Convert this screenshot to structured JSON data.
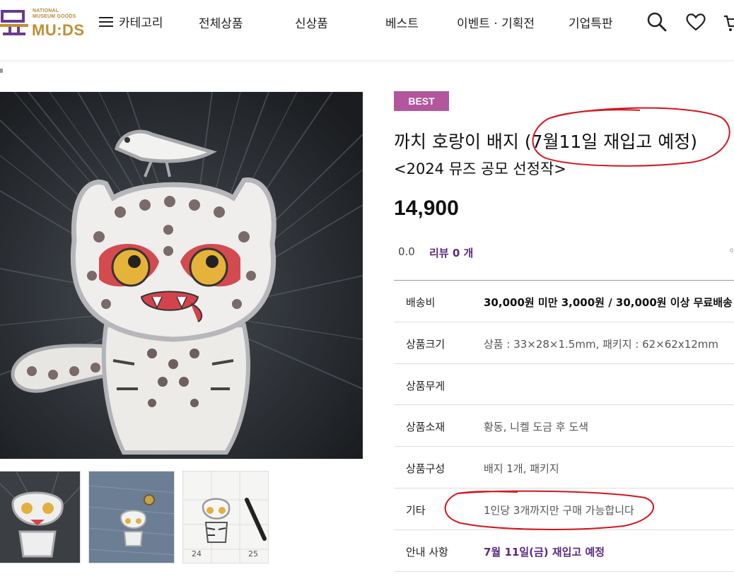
{
  "header": {
    "logo_small_line1": "NATIONAL",
    "logo_small_line2": "MUSEUM GOODS",
    "logo_text": "MU:DS",
    "category_label": "카테고리",
    "nav": [
      "전체상품",
      "신상품",
      "베스트",
      "이벤트 · 기획전",
      "기업특판"
    ],
    "icons": [
      "search-icon",
      "heart-icon",
      "cart-icon"
    ]
  },
  "product": {
    "badge": "BEST",
    "title": "까치 호랑이 배지 (7월11일 재입고 예정)",
    "subtitle": "<2024 뮤즈 공모 선정작>",
    "price": "14,900",
    "rating": "0.0",
    "review_label": "리뷰 0 개"
  },
  "details": [
    {
      "key": "배송비",
      "value": "30,000원 미만 3,000원 / 30,000원 이상 무료배송",
      "style": "bold"
    },
    {
      "key": "상품크기",
      "value": "상품 : 33×28×1.5mm, 패키지 : 62×62x12mm",
      "style": "normal"
    },
    {
      "key": "상품무게",
      "value": "",
      "style": "normal"
    },
    {
      "key": "상품소재",
      "value": "황동, 니켈 도금 후 도색",
      "style": "normal"
    },
    {
      "key": "상품구성",
      "value": "배지 1개, 패키지",
      "style": "normal"
    },
    {
      "key": "기타",
      "value": "1인당 3개까지만 구매 가능합니다",
      "style": "normal"
    },
    {
      "key": "안내 사항",
      "value": "7월 11일(금) 재입고 예정",
      "style": "purple"
    }
  ],
  "thumbnails": [
    {
      "num_a": "",
      "num_b": ""
    },
    {
      "num_a": "",
      "num_b": ""
    },
    {
      "num_a": "24",
      "num_b": "25"
    }
  ],
  "colors": {
    "badge": "#b2569e",
    "accent_purple": "#5b2a80",
    "logo_gold": "#c09033",
    "annotation_red": "#d6141c"
  }
}
